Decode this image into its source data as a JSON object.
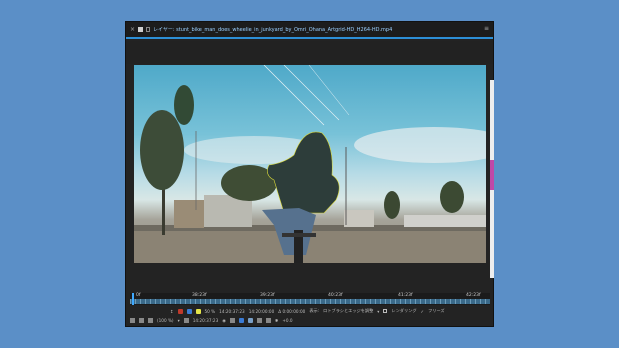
{
  "window": {
    "title": "レイヤー: stunt_bike_man_does_wheelie_in_junkyard_by_Omri_Ohana_Artgrid-HD_H264-HD.mp4"
  },
  "timeline": {
    "labels": [
      "0f",
      "38:23f",
      "39:23f",
      "40:23f",
      "41:23f",
      "42:23f"
    ]
  },
  "toolbar1": {
    "zoom": "50 %",
    "timecode_in": "14:20:37:23",
    "timecode_out": "14:20:00:00",
    "duration": "Δ 0:00:00:00",
    "view_label": "表示:",
    "view_value": "ロトブラシとエッジを調整",
    "rendering_label": "レンダリング",
    "freeze_label": "フリーズ"
  },
  "toolbar2": {
    "magnification": "(100 %)",
    "current_time": "14:20:37:23",
    "plus_value": "+0.0"
  },
  "colors": {
    "accent": "#2d8fd6",
    "background": "#5b8fc7",
    "panel": "#232323"
  }
}
